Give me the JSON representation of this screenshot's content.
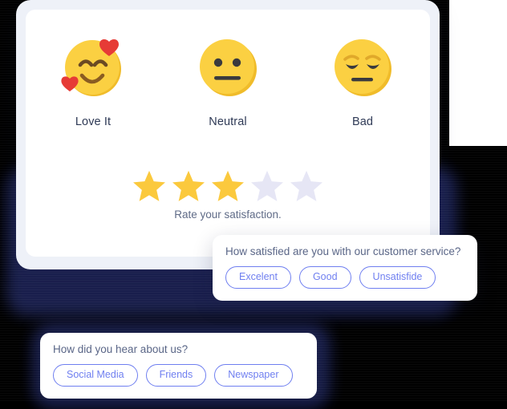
{
  "colors": {
    "page_background": "#ffffff",
    "shadow_dark": "#1b2150",
    "card_frame": "#eef1f8",
    "card_surface": "#ffffff",
    "emoji_yellow": "#fbd042",
    "emoji_yellow_shade": "#f0bc2a",
    "heart_red": "#e63b36",
    "star_filled": "#fbc93d",
    "star_empty": "#e6e6f5",
    "label_navy": "#2f3a56",
    "muted_slate": "#5a6687",
    "pill_indigo": "#6f7ff0"
  },
  "main_card": {
    "emoji_options": [
      {
        "icon": "smiling-face-with-hearts-icon",
        "label": "Love It"
      },
      {
        "icon": "neutral-face-icon",
        "label": "Neutral"
      },
      {
        "icon": "sad-pensive-face-icon",
        "label": "Bad"
      }
    ],
    "rating": {
      "caption": "Rate your satisfaction.",
      "value": 3,
      "max": 5,
      "stars": [
        "filled",
        "filled",
        "filled",
        "empty",
        "empty"
      ]
    }
  },
  "service_card": {
    "question": "How satisfied are you with our customer service?",
    "options": [
      "Excelent",
      "Good",
      "Unsatisfide"
    ]
  },
  "source_card": {
    "question": "How did you hear about us?",
    "options": [
      "Social Media",
      "Friends",
      "Newspaper"
    ]
  }
}
